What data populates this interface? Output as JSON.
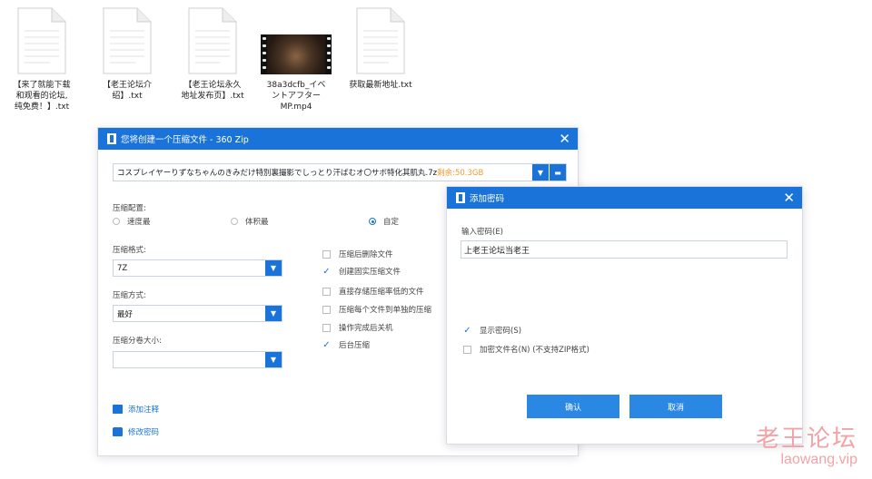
{
  "desktop": {
    "files": [
      {
        "name": "【来了就能下载\n和观看的论坛,\n纯免费！】.txt",
        "type": "txt"
      },
      {
        "name": "【老王论坛介\n绍】.txt",
        "type": "txt"
      },
      {
        "name": "【老王论坛永久\n地址发布页】.txt",
        "type": "txt"
      },
      {
        "name": "38a3dcfb_イベ\nントアフター\nMP.mp4",
        "type": "video"
      },
      {
        "name": "获取最新地址.txt",
        "type": "txt"
      }
    ]
  },
  "main_dialog": {
    "title": "您将创建一个压缩文件 - 360 Zip",
    "path": "コスプレイヤーりずなちゃんのきみだけ特別裏撮影でしっとり汗ばむオ〇サボ特化其肌丸.7z",
    "free_space": "剩余:50.3GB",
    "config_label": "压缩配置:",
    "radios": [
      {
        "label": "速度最",
        "checked": false
      },
      {
        "label": "体积最",
        "checked": false
      },
      {
        "label": "自定",
        "checked": true
      }
    ],
    "format_label": "压缩格式:",
    "format_value": "7Z",
    "method_label": "压缩方式:",
    "method_value": "最好",
    "volume_label": "压缩分卷大小:",
    "volume_value": "",
    "options": [
      {
        "label": "压缩后删除文件",
        "checked": false
      },
      {
        "label": "创建固实压缩文件",
        "checked": true
      },
      {
        "label": "直接存储压缩率低的文件",
        "checked": false
      },
      {
        "label": "压缩每个文件到单独的压缩",
        "checked": false
      },
      {
        "label": "操作完成后关机",
        "checked": false
      },
      {
        "label": "后台压缩",
        "checked": true
      }
    ],
    "add_comment": "添加注释",
    "change_password": "修改密码"
  },
  "password_dialog": {
    "title": "添加密码",
    "input_label": "输入密码(E)",
    "password": "上老王论坛当老王",
    "show_password": {
      "label": "显示密码(S)",
      "checked": true
    },
    "encrypt_names": {
      "label": "加密文件名(N) (不支持ZIP格式)",
      "checked": false
    },
    "ok": "确认",
    "cancel": "取消"
  },
  "watermark": {
    "cn": "老王论坛",
    "en": "laowang.vip"
  },
  "colors": {
    "accent": "#1a73d9",
    "button": "#2b87e4",
    "free_space": "#f39a2b",
    "watermark": "#f1a3a6"
  }
}
